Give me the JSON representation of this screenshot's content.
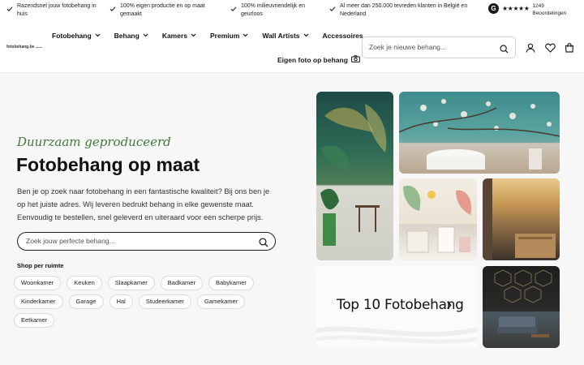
{
  "usp": [
    {
      "text": "Razendsnel jouw fotobehang in huis"
    },
    {
      "text": "100% eigen productie en op maat gemaakt"
    },
    {
      "text": "100% milieuvriendelijk en geurloos"
    },
    {
      "text": "Al meer dan 250.000 tevreden klanten in België en Nederland"
    }
  ],
  "rating": {
    "logo": "G",
    "stars": "★★★★★",
    "count": "1249",
    "label": "Beoordelingen"
  },
  "logo": {
    "text": "fotobehang.be"
  },
  "nav": {
    "items": [
      {
        "label": "Fotobehang",
        "chevron": "⌄"
      },
      {
        "label": "Behang",
        "chevron": "⌄"
      },
      {
        "label": "Kamers",
        "chevron": "⌄"
      },
      {
        "label": "Premium",
        "chevron": "⌄"
      },
      {
        "label": "Wall Artists",
        "chevron": "⌄"
      },
      {
        "label": "Accessoires",
        "chevron": ""
      }
    ],
    "photo_label": "Eigen foto op behang"
  },
  "header_search": {
    "placeholder": "Zoek je nieuwe behang..."
  },
  "hero": {
    "tagline": "Duurzaam geproduceerd",
    "title": "Fotobehang op maat",
    "description": "Ben je op zoek naar fotobehang in een fantastische kwaliteit? Bij ons ben je op het juiste adres. Wij leveren bedrukt behang in elke gewenste maat. Eenvoudig te bestellen, snel geleverd en uiteraard voor een scherpe prijs.",
    "search_placeholder": "Zoek jouw perfecte behang..."
  },
  "rooms": {
    "label": "Shop per ruimte",
    "items": [
      "Woonkamer",
      "Keuken",
      "Slaapkamer",
      "Badkamer",
      "Babykamer",
      "Kinderkamer",
      "Garage",
      "Hal",
      "Studeerkamer",
      "Gamekamer",
      "Eetkamer"
    ]
  },
  "promo": {
    "title": "Top 10 Fotobehang",
    "arrow": "›"
  },
  "colors": {
    "accent_green": "#3f7a3a",
    "text": "#111111",
    "background": "#f7f7f7"
  }
}
